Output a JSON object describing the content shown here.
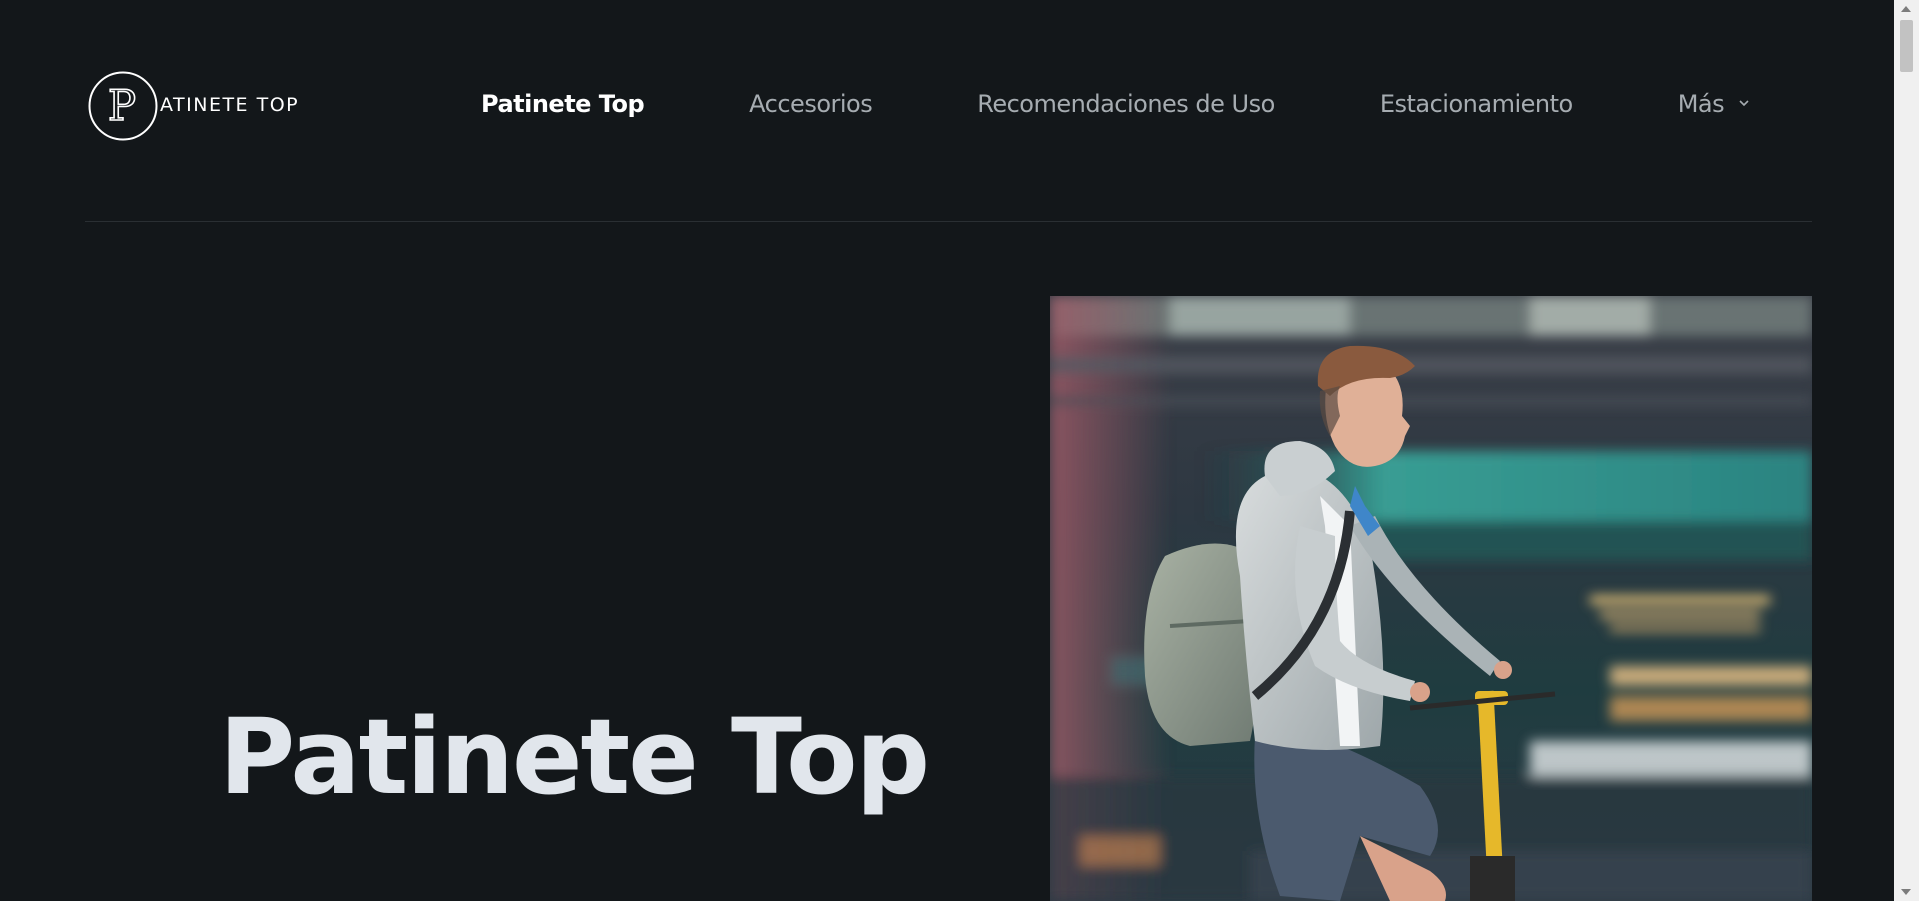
{
  "brand": {
    "logo_letter": "P",
    "logo_text": "ATINETE TOP"
  },
  "nav": {
    "items": [
      {
        "label": "Patinete Top",
        "active": true
      },
      {
        "label": "Accesorios",
        "active": false
      },
      {
        "label": "Recomendaciones de Uso",
        "active": false
      },
      {
        "label": "Estacionamiento",
        "active": false
      }
    ],
    "more_label": "Más"
  },
  "hero": {
    "title": "Patinete Top"
  },
  "colors": {
    "background": "#13171a",
    "nav_active": "#ffffff",
    "nav_inactive": "#a6acb1",
    "title": "#e1e6ec"
  },
  "icons": {
    "logo": "circle-p-logo-icon",
    "more": "chevron-down-icon"
  }
}
